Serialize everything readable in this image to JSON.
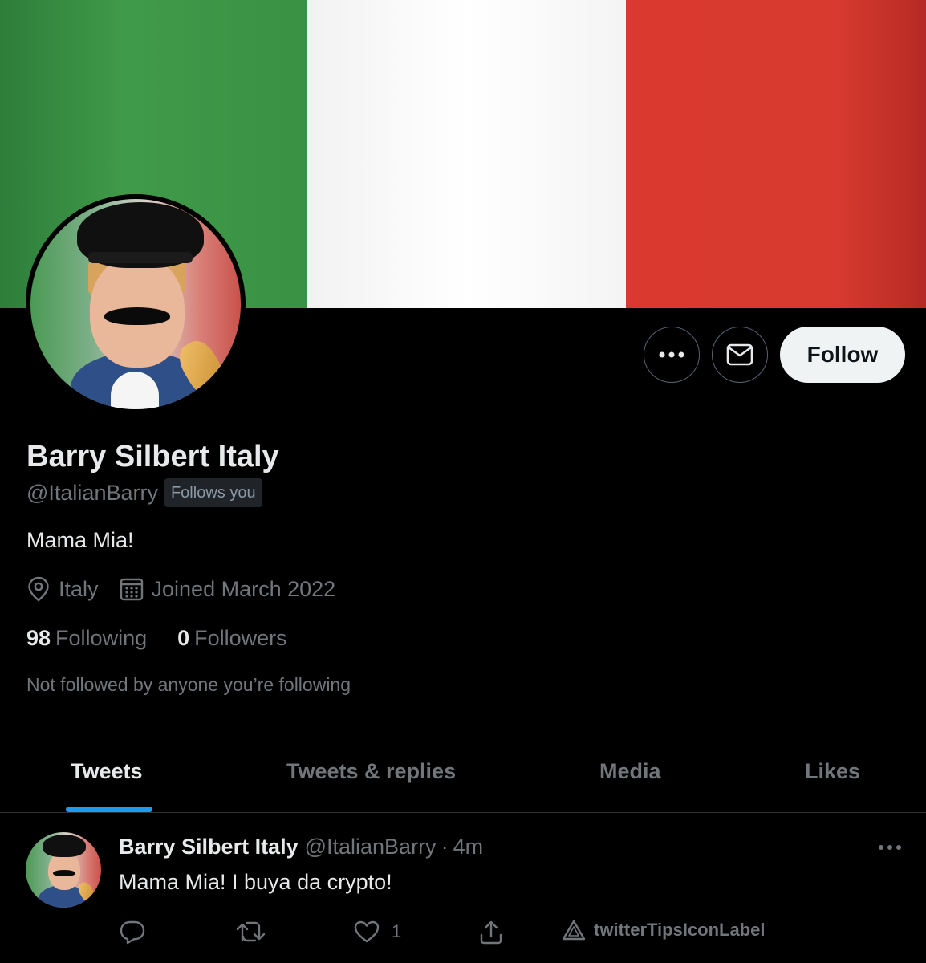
{
  "profile": {
    "name": "Barry Silbert Italy",
    "handle": "@ItalianBarry",
    "follows_badge": "Follows you",
    "bio": "Mama Mia!",
    "location": "Italy",
    "joined": "Joined March 2022",
    "following_count": "98",
    "following_label": "Following",
    "followers_count": "0",
    "followers_label": "Followers",
    "not_followed_text": "Not followed by anyone you’re following"
  },
  "buttons": {
    "more_icon": "ellipsis-icon",
    "message_icon": "mail-icon",
    "follow_label": "Follow"
  },
  "tabs": [
    {
      "label": "Tweets",
      "active": true
    },
    {
      "label": "Tweets & replies",
      "active": false
    },
    {
      "label": "Media",
      "active": false
    },
    {
      "label": "Likes",
      "active": false
    }
  ],
  "tweet": {
    "name": "Barry Silbert Italy",
    "handle": "@ItalianBarry",
    "separator": "·",
    "time": "4m",
    "text": "Mama Mia! I buya da crypto!",
    "like_count": "1",
    "tips_label": "twitterTipsIconLabel"
  },
  "colors": {
    "background": "#000000",
    "accent": "#1d9bf0",
    "flag_green": "#3a9244",
    "flag_white": "#ffffff",
    "flag_red": "#d83a30"
  }
}
